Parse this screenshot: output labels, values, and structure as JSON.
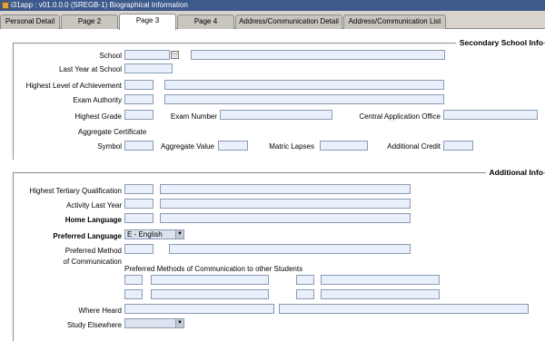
{
  "window": {
    "title": "i31app : v01.0.0.0 (SREGB-1) Biographical Information"
  },
  "tabs": [
    "Personal Detail",
    "Page 2",
    "Page 3",
    "Page 4",
    "Address/Communication Detail",
    "Address/Communication List"
  ],
  "secondary": {
    "title": "Secondary School Info",
    "school": "School",
    "last_year": "Last Year at School",
    "highest_level": "Highest Level of Achievement",
    "exam_authority": "Exam Authority",
    "highest_grade": "Highest Grade",
    "exam_number": "Exam Number",
    "central_office": "Central Application Office",
    "aggregate_cert": "Aggregate Certificate",
    "symbol": "Symbol",
    "aggregate_value": "Aggregate Value",
    "matric_lapses": "Matric Lapses",
    "additional_credit": "Additional Credit",
    "lookup_glyph": "..."
  },
  "additional": {
    "title": "Additional Info",
    "highest_tertiary": "Highest Tertiary Qualification",
    "activity_last_year": "Activity Last Year",
    "home_language": "Home Language",
    "preferred_language": "Preferred Language",
    "preferred_language_value": "E - English",
    "preferred_method_1": "Preferred Method",
    "preferred_method_2": "of Communication",
    "methods_other": "Preferred Methods of Communication to other Students",
    "where_heard": "Where Heard",
    "study_elsewhere": "Study Elsewhere",
    "study_elsewhere_value": ""
  },
  "colors": {
    "titlebar": "#3d5a8c",
    "field_fill": "#eaf0fb",
    "field_border": "#8a9bb5",
    "tabbar": "#d8d4cc"
  }
}
